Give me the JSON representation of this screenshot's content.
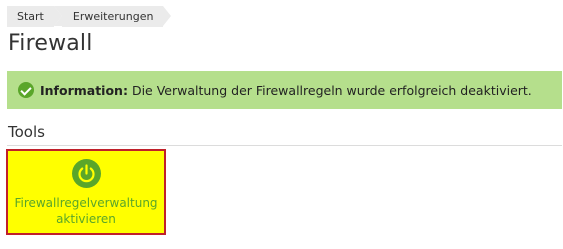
{
  "breadcrumb": {
    "items": [
      {
        "label": "Start"
      },
      {
        "label": "Erweiterungen"
      }
    ]
  },
  "page": {
    "title": "Firewall"
  },
  "alert": {
    "type": "success",
    "icon": "check-circle-icon",
    "prefix": "Information:",
    "message": "Die Verwaltung der Firewallregeln wurde erfolgreich deaktiviert."
  },
  "tools": {
    "section_title": "Tools",
    "items": [
      {
        "label": "Firewallregelverwaltung aktivieren",
        "icon": "power-icon",
        "highlighted": true
      }
    ]
  },
  "colors": {
    "alert_background": "#b5df8c",
    "accent_green": "#5aa62a",
    "highlight_yellow": "#ffff00",
    "highlight_border": "#c0202a"
  }
}
